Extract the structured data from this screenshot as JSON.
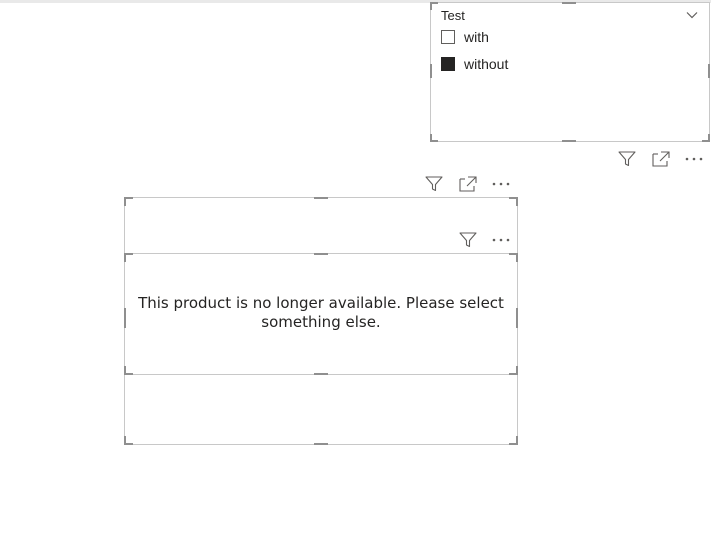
{
  "slicer": {
    "title": "Test",
    "items": [
      {
        "label": "with",
        "checked": false
      },
      {
        "label": "without",
        "checked": true
      }
    ]
  },
  "card": {
    "message": "This product is no longer available. Please select something else."
  },
  "colors": {
    "frame": "#c8c8c8",
    "handle": "#8f8f8f",
    "icon": "#605e5c",
    "text": "#252423"
  },
  "icons": [
    "filter-icon",
    "focus-mode-icon",
    "more-options-icon",
    "chevron-down-icon"
  ]
}
